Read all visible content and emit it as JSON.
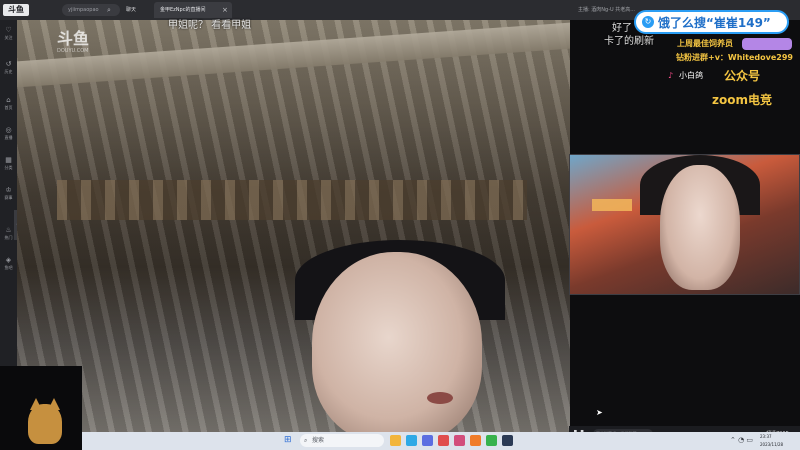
{
  "browser": {
    "logo_text": "斗鱼",
    "search_placeholder": "yjiimpaopao",
    "nav_chat": "聊天",
    "active_tab": "金甲EzNpc的直播间",
    "tab_close": "×",
    "top_right_text": "主播: 酒肉Ng-U 共老高..."
  },
  "sidebar": {
    "items": [
      {
        "icon": "♡",
        "label": "关注"
      },
      {
        "icon": "↺",
        "label": "历史"
      },
      {
        "icon": "⌂",
        "label": "首页"
      },
      {
        "icon": "◎",
        "label": "直播"
      },
      {
        "icon": "▦",
        "label": "分类"
      },
      {
        "icon": "♔",
        "label": "赛事"
      },
      {
        "icon": "♨",
        "label": "热门"
      },
      {
        "icon": "◈",
        "label": "鱼吧"
      }
    ],
    "collapse_icon": "‹"
  },
  "video": {
    "watermark": "斗鱼",
    "watermark_sub": "DOUYU.COM"
  },
  "danmaku": [
    "甲姐呢？ 看看甲姐",
    "好了",
    "卡了的刷新"
  ],
  "promo": {
    "icon": "↻",
    "text": "饿了么搜“崔崔149”"
  },
  "overlay": {
    "line1": "上周最佳饲养员",
    "line2": "钻粉进群+v：Whitedove299",
    "line3_icon": "♪",
    "line3": "小白鸽",
    "line4": "公众号",
    "line5": "zoom电竞"
  },
  "controls": {
    "play_icon": "❚❚",
    "danmaku_placeholder": "开启弹幕吧~ 发送弹幕",
    "quality": "超清720P"
  },
  "taskbar": {
    "start_icon": "⊞",
    "search_label": "搜索",
    "search_icon": "⌕",
    "tray": "⌃ ◔ ▭",
    "time": "23:37",
    "date": "2023/11/28"
  },
  "colors": {
    "accent_blue": "#2a9df4",
    "overlay_yellow": "#f4c542",
    "overlay_purple": "#b486e6"
  }
}
